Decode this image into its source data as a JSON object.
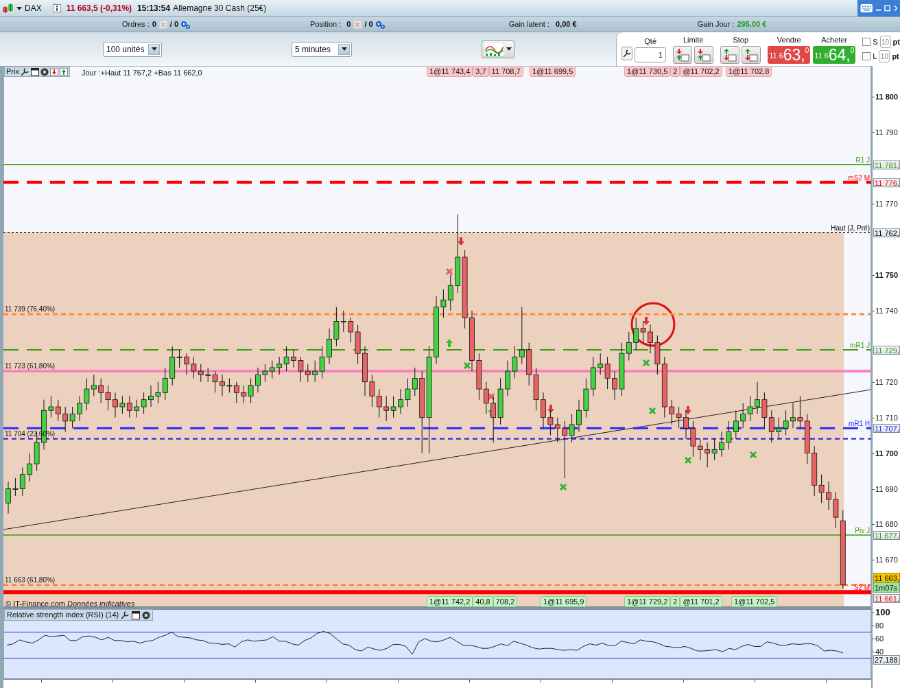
{
  "title_bar": {
    "symbol": "DAX",
    "quote": "11 663,5 (-0,31%)",
    "time": "15:13:54",
    "instrument": "Allemagne 30 Cash (25€)"
  },
  "info_bar": {
    "orders_label": "Ordres :",
    "orders_count": "0",
    "orders_total": "/ 0",
    "position_label": "Position :",
    "position_count": "0",
    "position_total": "/ 0",
    "latent_label": "Gain latent :",
    "latent_value": "0,00 €",
    "day_label": "Gain Jour :",
    "day_value": "295,00 €"
  },
  "toolbar": {
    "size_select": "100 unités",
    "period_select": "5 minutes"
  },
  "trade_panel": {
    "qty_label": "Qté",
    "qty_value": "1",
    "limit_label": "Limite",
    "stop_label": "Stop",
    "sell": {
      "label": "Vendre",
      "prefix": "11 6",
      "big": "63,",
      "sup": "0"
    },
    "buy": {
      "label": "Acheter",
      "prefix": "11 6",
      "big": "64,",
      "sup": "0"
    },
    "options": [
      {
        "label": "S",
        "checked": false,
        "placeholder": "10",
        "unit": "pt"
      },
      {
        "label": "L",
        "checked": false,
        "placeholder": "10",
        "unit": "pt"
      }
    ]
  },
  "chart": {
    "title": "Prix",
    "summary": "Jour :+Haut 11 767,2 +Bas 11 662,0",
    "top_orders": [
      {
        "tags": [
          "1@11 743,4",
          "3,7",
          "11 708,7"
        ]
      },
      {
        "tags": [
          "1@11 699,5"
        ]
      },
      {
        "tags": [
          "1@11 730,5",
          "2",
          "@11 702,2"
        ]
      },
      {
        "tags": [
          "1@11 702,8"
        ]
      }
    ],
    "bottom_orders": [
      {
        "tags": [
          "1@11 742,2",
          "40,8",
          "708,2"
        ]
      },
      {
        "tags": [
          "1@11 695,9"
        ]
      },
      {
        "tags": [
          "1@11 729,2",
          "2",
          "@11 701,2"
        ]
      },
      {
        "tags": [
          "1@11 702,5"
        ]
      }
    ],
    "levels": [
      {
        "kind": "pivot",
        "name": "R1 J",
        "box": "11 781,"
      },
      {
        "kind": "pivot",
        "name": "mS2 M",
        "box": "11 776,"
      },
      {
        "kind": "pivot",
        "name": "Haut (J, Pré)",
        "box": "11 762,"
      },
      {
        "kind": "fibo",
        "name": "11 739 (76,40%)"
      },
      {
        "kind": "pivot",
        "name": "mR1 J",
        "box": "11 729,"
      },
      {
        "kind": "fibo",
        "name": "11 723 (61,80%)"
      },
      {
        "kind": "pivot",
        "name": "mR1 H",
        "box": "11 707,"
      },
      {
        "kind": "fibo",
        "name": "11 704 (23,60%)"
      },
      {
        "kind": "pivot",
        "name": "Piv J",
        "box": "11 677,"
      },
      {
        "kind": "fibo",
        "name": "11 663 (61,80%)"
      },
      {
        "kind": "pivot",
        "name": "S2 M",
        "box": "11 661,"
      }
    ],
    "chart_data": {
      "type": "candlestick",
      "ylim": [
        11656.6,
        11808.7
      ],
      "ref_lines": [
        {
          "axis": "y",
          "value": 11781,
          "color": "#3f9a10"
        },
        {
          "axis": "y",
          "value": 11776,
          "color": "#ff0000"
        },
        {
          "axis": "y",
          "value": 11762,
          "color": "#000000"
        },
        {
          "axis": "y",
          "value": 11739,
          "color": "#ff8a3c"
        },
        {
          "axis": "y",
          "value": 11729,
          "color": "#3f9a10"
        },
        {
          "axis": "y",
          "value": 11723,
          "color": "#ff80c0"
        },
        {
          "axis": "y",
          "value": 11707,
          "color": "#2a2aff"
        },
        {
          "axis": "y",
          "value": 11704,
          "color": "#2020e0"
        },
        {
          "axis": "y",
          "value": 11677,
          "color": "#3f9a10"
        },
        {
          "axis": "y",
          "value": 11663,
          "color": "#ff8a3c"
        },
        {
          "axis": "y",
          "value": 11661,
          "color": "#ff0000"
        }
      ],
      "ohlc": [
        [
          11686,
          11692,
          11683,
          11690
        ],
        [
          11690,
          11693,
          11688,
          11690
        ],
        [
          11690,
          11696,
          11688,
          11694
        ],
        [
          11694,
          11700,
          11692,
          11697
        ],
        [
          11697,
          11706,
          11695,
          11703
        ],
        [
          11703,
          11715,
          11701,
          11712
        ],
        [
          11712,
          11716,
          11710,
          11713
        ],
        [
          11713,
          11715,
          11709,
          11711
        ],
        [
          11711,
          11713,
          11706,
          11709
        ],
        [
          11709,
          11713,
          11707,
          11711
        ],
        [
          11711,
          11716,
          11709,
          11714
        ],
        [
          11714,
          11721,
          11712,
          11718
        ],
        [
          11718,
          11722,
          11716,
          11719
        ],
        [
          11719,
          11721,
          11714,
          11717
        ],
        [
          11717,
          11719,
          11712,
          11715
        ],
        [
          11715,
          11717,
          11710,
          11713
        ],
        [
          11713,
          11716,
          11711,
          11714
        ],
        [
          11714,
          11716,
          11710,
          11712
        ],
        [
          11712,
          11715,
          11710,
          11713
        ],
        [
          11713,
          11717,
          11711,
          11715
        ],
        [
          11715,
          11719,
          11713,
          11716
        ],
        [
          11716,
          11720,
          11714,
          11717
        ],
        [
          11717,
          11724,
          11715,
          11721
        ],
        [
          11721,
          11730,
          11719,
          11727
        ],
        [
          11727,
          11729,
          11724,
          11727
        ],
        [
          11727,
          11728,
          11722,
          11725
        ],
        [
          11725,
          11727,
          11721,
          11723
        ],
        [
          11723,
          11725,
          11720,
          11722
        ],
        [
          11722,
          11724,
          11720,
          11722
        ],
        [
          11722,
          11723,
          11717,
          11720
        ],
        [
          11720,
          11722,
          11716,
          11719
        ],
        [
          11719,
          11721,
          11717,
          11719
        ],
        [
          11719,
          11720,
          11714,
          11717
        ],
        [
          11717,
          11719,
          11714,
          11716
        ],
        [
          11716,
          11721,
          11714,
          11719
        ],
        [
          11719,
          11724,
          11717,
          11722
        ],
        [
          11722,
          11725,
          11720,
          11723
        ],
        [
          11723,
          11726,
          11721,
          11724
        ],
        [
          11724,
          11727,
          11722,
          11725
        ],
        [
          11725,
          11730,
          11723,
          11727
        ],
        [
          11727,
          11729,
          11724,
          11726
        ],
        [
          11726,
          11727,
          11720,
          11723
        ],
        [
          11723,
          11725,
          11720,
          11722
        ],
        [
          11722,
          11726,
          11720,
          11723
        ],
        [
          11723,
          11730,
          11721,
          11727
        ],
        [
          11727,
          11735,
          11725,
          11732
        ],
        [
          11732,
          11741,
          11730,
          11737
        ],
        [
          11737,
          11740,
          11734,
          11737
        ],
        [
          11737,
          11738,
          11731,
          11734
        ],
        [
          11734,
          11736,
          11725,
          11728
        ],
        [
          11728,
          11730,
          11716,
          11720
        ],
        [
          11720,
          11722,
          11713,
          11716
        ],
        [
          11716,
          11718,
          11710,
          11713
        ],
        [
          11713,
          11716,
          11709,
          11712
        ],
        [
          11712,
          11716,
          11710,
          11713
        ],
        [
          11713,
          11718,
          11711,
          11715
        ],
        [
          11715,
          11721,
          11713,
          11718
        ],
        [
          11718,
          11724,
          11716,
          11721
        ],
        [
          11721,
          11723,
          11700,
          11710
        ],
        [
          11710,
          11730,
          11700,
          11727
        ],
        [
          11727,
          11744,
          11725,
          11741
        ],
        [
          11741,
          11746,
          11738,
          11743
        ],
        [
          11743,
          11750,
          11740,
          11747
        ],
        [
          11747,
          11767,
          11745,
          11755
        ],
        [
          11755,
          11757,
          11735,
          11738
        ],
        [
          11738,
          11740,
          11723,
          11726
        ],
        [
          11726,
          11728,
          11715,
          11718
        ],
        [
          11718,
          11720,
          11711,
          11714
        ],
        [
          11714,
          11716,
          11703,
          11710
        ],
        [
          11710,
          11721,
          11708,
          11718
        ],
        [
          11718,
          11726,
          11716,
          11723
        ],
        [
          11723,
          11730,
          11721,
          11727
        ],
        [
          11727,
          11741,
          11725,
          11729
        ],
        [
          11729,
          11731,
          11719,
          11722
        ],
        [
          11722,
          11724,
          11712,
          11715
        ],
        [
          11715,
          11717,
          11707,
          11710
        ],
        [
          11710,
          11712,
          11705,
          11708
        ],
        [
          11708,
          11710,
          11703,
          11707
        ],
        [
          11707,
          11709,
          11693,
          11705
        ],
        [
          11705,
          11711,
          11703,
          11708
        ],
        [
          11708,
          11715,
          11706,
          11712
        ],
        [
          11712,
          11721,
          11710,
          11718
        ],
        [
          11718,
          11727,
          11716,
          11724
        ],
        [
          11724,
          11728,
          11722,
          11725
        ],
        [
          11725,
          11727,
          11718,
          11721
        ],
        [
          11721,
          11723,
          11715,
          11718
        ],
        [
          11718,
          11731,
          11716,
          11728
        ],
        [
          11728,
          11734,
          11726,
          11731
        ],
        [
          11731,
          11738,
          11729,
          11735
        ],
        [
          11735,
          11737,
          11731,
          11734
        ],
        [
          11734,
          11736,
          11728,
          11731
        ],
        [
          11731,
          11733,
          11722,
          11725
        ],
        [
          11725,
          11727,
          11710,
          11713
        ],
        [
          11713,
          11715,
          11708,
          11711
        ],
        [
          11711,
          11713,
          11707,
          11710
        ],
        [
          11710,
          11712,
          11704,
          11707
        ],
        [
          11707,
          11709,
          11699,
          11702
        ],
        [
          11702,
          11704,
          11698,
          11701
        ],
        [
          11701,
          11703,
          11696,
          11700
        ],
        [
          11700,
          11704,
          11698,
          11701
        ],
        [
          11701,
          11706,
          11699,
          11703
        ],
        [
          11703,
          11709,
          11701,
          11706
        ],
        [
          11706,
          11712,
          11704,
          11709
        ],
        [
          11709,
          11714,
          11707,
          11711
        ],
        [
          11711,
          11716,
          11709,
          11713
        ],
        [
          11713,
          11720,
          11711,
          11715
        ],
        [
          11715,
          11717,
          11707,
          11710
        ],
        [
          11710,
          11712,
          11703,
          11706
        ],
        [
          11706,
          11710,
          11704,
          11707
        ],
        [
          11707,
          11712,
          11705,
          11709
        ],
        [
          11709,
          11714,
          11707,
          11710
        ],
        [
          11710,
          11716,
          11707,
          11709
        ],
        [
          11709,
          11711,
          11697,
          11700
        ],
        [
          11700,
          11702,
          11688,
          11691
        ],
        [
          11691,
          11694,
          11686,
          11689
        ],
        [
          11689,
          11692,
          11684,
          11687
        ],
        [
          11687,
          11689,
          11679,
          11682
        ],
        [
          11681,
          11684,
          11662,
          11663
        ]
      ],
      "yticks": [
        {
          "value": 11800,
          "label": "11 800"
        },
        {
          "value": 11790,
          "label": "11 790"
        },
        {
          "value": 11770,
          "label": "11 770"
        },
        {
          "value": 11750,
          "label": "11 750"
        },
        {
          "value": 11740,
          "label": "11 740"
        },
        {
          "value": 11720,
          "label": "11 720"
        },
        {
          "value": 11710,
          "label": "11 710"
        },
        {
          "value": 11700,
          "label": "11 700"
        },
        {
          "value": 11690,
          "label": "11 690"
        },
        {
          "value": 11680,
          "label": "11 680"
        },
        {
          "value": 11670,
          "label": "11 670"
        }
      ]
    },
    "last_price": "11 663,",
    "timer": "1m07s",
    "footer": "© IT-Finance.com *Données indicatives*"
  },
  "rsi": {
    "title": "Relative strength index (RSI) (14)",
    "value": "27,188",
    "chart_data": {
      "type": "line",
      "ylim": [
        -3.2,
        106.3
      ],
      "yticks": [
        40,
        60,
        80,
        100
      ],
      "ref_lines": [
        {
          "axis": "y",
          "value": 70,
          "color": "#3030d0"
        },
        {
          "axis": "y",
          "value": 30,
          "color": "#3030d0"
        }
      ],
      "series": [
        {
          "color": "#222222",
          "values": [
            50,
            52,
            58,
            55,
            53,
            58,
            65,
            63,
            64,
            65,
            57,
            57,
            63,
            64,
            62,
            58,
            62,
            57,
            57,
            55,
            56,
            53,
            56,
            57,
            62,
            65,
            70,
            63,
            62,
            61,
            58,
            57,
            53,
            53,
            51,
            52,
            47,
            55,
            58,
            56,
            57,
            58,
            63,
            56,
            56,
            52,
            50,
            57,
            61,
            68,
            71,
            68,
            60,
            52,
            50,
            43,
            41,
            47,
            44,
            42,
            45,
            51,
            51,
            48,
            36,
            55,
            60,
            56,
            55,
            58,
            62,
            56,
            50,
            50,
            48,
            45,
            45,
            48,
            52,
            49,
            56,
            53,
            50,
            46,
            44,
            45,
            45,
            43,
            42,
            43,
            42,
            48,
            52,
            50,
            53,
            49,
            49,
            56,
            54,
            52,
            58,
            56,
            55,
            52,
            48,
            47,
            46,
            48,
            45,
            41,
            41,
            42,
            43,
            40,
            45,
            43,
            48,
            51,
            48,
            48,
            55,
            53,
            50,
            50,
            52,
            51,
            52,
            52,
            49,
            41,
            42,
            41,
            38
          ]
        }
      ]
    }
  }
}
